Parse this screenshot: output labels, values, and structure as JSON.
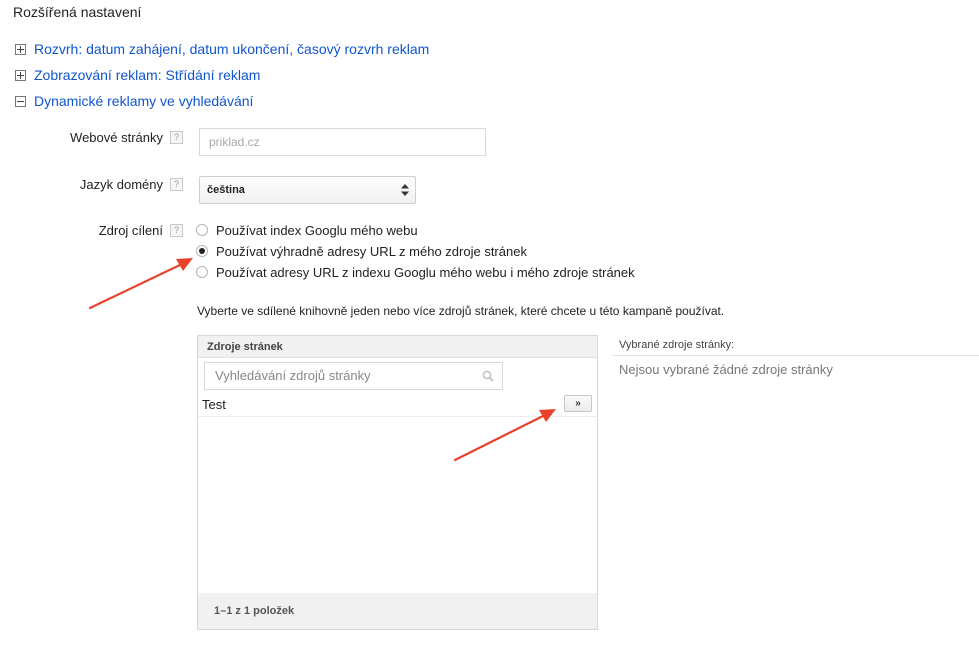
{
  "section": {
    "title": "Rozšířená nastavení"
  },
  "expanders": [
    {
      "label": "Rozvrh: datum zahájení, datum ukončení, časový rozvrh reklam",
      "expanded": false
    },
    {
      "label": "Zobrazování reklam: Střídání reklam",
      "expanded": false
    },
    {
      "label": "Dynamické reklamy ve vyhledávání",
      "expanded": true
    }
  ],
  "help_glyph": "?",
  "fields": {
    "website": {
      "label": "Webové stránky",
      "placeholder": "priklad.cz",
      "value": ""
    },
    "language": {
      "label": "Jazyk domény",
      "value": "čeština"
    },
    "targeting": {
      "label": "Zdroj cílení",
      "options": [
        "Používat index Googlu mého webu",
        "Používat výhradně adresy URL z mého zdroje stránek",
        "Používat adresy URL z indexu Googlu mého webu i mého zdroje stránek"
      ],
      "selected_index": 1
    }
  },
  "instruction": "Vyberte ve sdílené knihovně jeden nebo více zdrojů stránek, které chcete u této kampaně používat.",
  "source_panel": {
    "header": "Zdroje stránek",
    "search_placeholder": "Vyhledávání zdrojů stránky",
    "items": [
      "Test"
    ],
    "add_label": "»",
    "footer": "1–1 z 1 položek"
  },
  "selected_panel": {
    "title": "Vybrané zdroje stránky:",
    "empty_text": "Nejsou vybrané žádné zdroje stránky"
  },
  "colors": {
    "link": "#1155cc",
    "annotation_arrow": "#e8412c"
  }
}
